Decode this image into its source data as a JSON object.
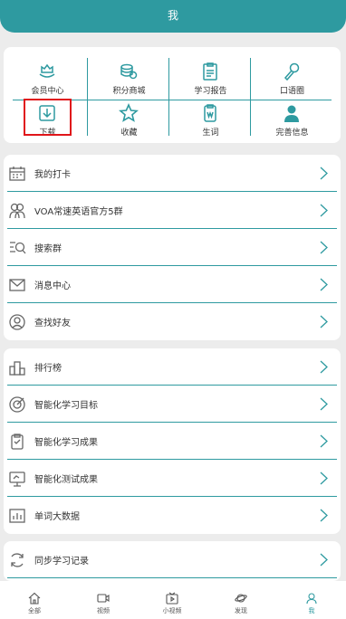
{
  "header": {
    "title": "我"
  },
  "grid": [
    {
      "label": "会员中心",
      "icon": "crown-hand-icon"
    },
    {
      "label": "积分商城",
      "icon": "coins-icon"
    },
    {
      "label": "学习报告",
      "icon": "report-icon"
    },
    {
      "label": "口语圈",
      "icon": "microphone-icon"
    },
    {
      "label": "下载",
      "icon": "download-icon"
    },
    {
      "label": "收藏",
      "icon": "star-icon"
    },
    {
      "label": "生词",
      "icon": "vocabulary-icon"
    },
    {
      "label": "完善信息",
      "icon": "user-icon"
    }
  ],
  "list1": [
    {
      "label": "我的打卡",
      "icon": "calendar-icon"
    },
    {
      "label": "VOA常速英语官方5群",
      "icon": "group-icon"
    },
    {
      "label": "搜索群",
      "icon": "search-list-icon"
    },
    {
      "label": "消息中心",
      "icon": "mail-icon"
    },
    {
      "label": "查找好友",
      "icon": "find-friend-icon"
    }
  ],
  "list2": [
    {
      "label": "排行榜",
      "icon": "ranking-icon"
    },
    {
      "label": "智能化学习目标",
      "icon": "target-icon"
    },
    {
      "label": "智能化学习成果",
      "icon": "clipboard-icon"
    },
    {
      "label": "智能化测试成果",
      "icon": "monitor-icon"
    },
    {
      "label": "单词大数据",
      "icon": "bar-chart-icon"
    }
  ],
  "list3": [
    {
      "label": "同步学习记录",
      "icon": "sync-icon"
    }
  ],
  "tabs": [
    {
      "label": "全部",
      "icon": "home-icon"
    },
    {
      "label": "视频",
      "icon": "video-icon"
    },
    {
      "label": "小视频",
      "icon": "tv-icon"
    },
    {
      "label": "发现",
      "icon": "planet-icon"
    },
    {
      "label": "我",
      "icon": "profile-icon"
    }
  ],
  "colors": {
    "accent": "#2e9aa0",
    "highlight": "#e0151a"
  }
}
